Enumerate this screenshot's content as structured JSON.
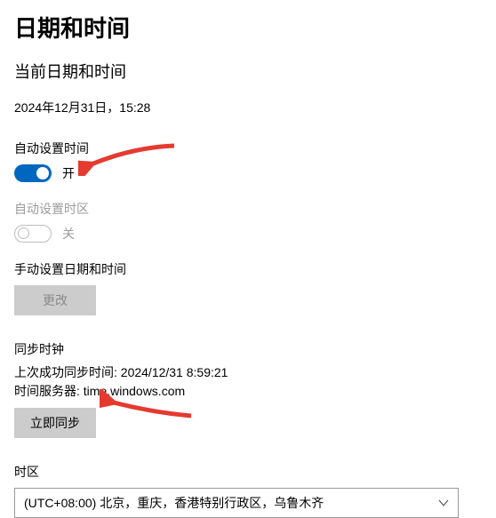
{
  "header": {
    "title": "日期和时间"
  },
  "current": {
    "heading": "当前日期和时间",
    "value": "2024年12月31日，15:28"
  },
  "autoTime": {
    "label": "自动设置时间",
    "state_label": "开"
  },
  "autoTz": {
    "label": "自动设置时区",
    "state_label": "关"
  },
  "manual": {
    "label": "手动设置日期和时间",
    "button": "更改"
  },
  "sync": {
    "heading": "同步时钟",
    "last_line": "上次成功同步时间: 2024/12/31 8:59:21",
    "server_line": "时间服务器: time.windows.com",
    "button": "立即同步"
  },
  "tz": {
    "label": "时区",
    "selected": "(UTC+08:00) 北京，重庆，香港特别行政区，乌鲁木齐"
  }
}
